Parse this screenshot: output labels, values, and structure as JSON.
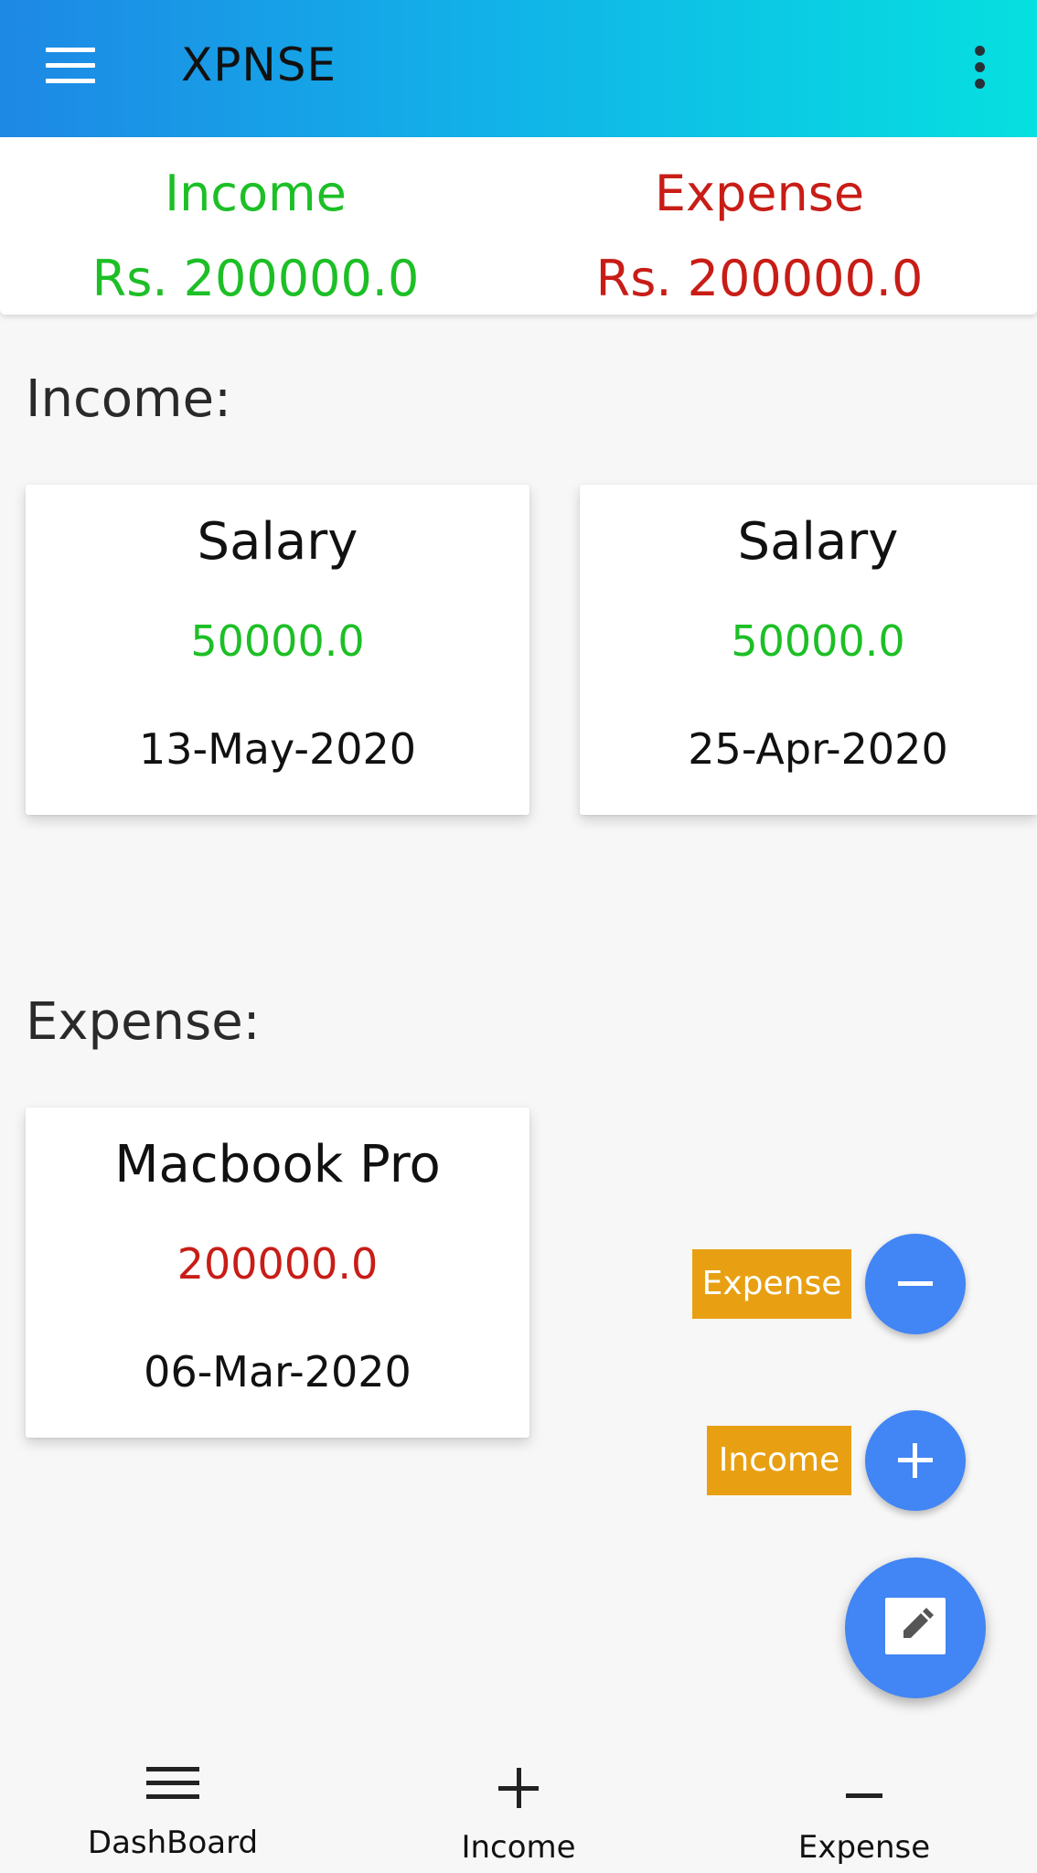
{
  "appbar": {
    "title": "XPNSE",
    "menu_icon": "menu-icon",
    "more_icon": "more-vert-icon"
  },
  "summary": {
    "income_label": "Income",
    "income_value": "Rs. 200000.0",
    "expense_label": "Expense",
    "expense_value": "Rs. 200000.0"
  },
  "income_section": {
    "title": "Income:",
    "cards": [
      {
        "title": "Salary",
        "amount": "50000.0",
        "date": "13-May-2020"
      },
      {
        "title": "Salary",
        "amount": "50000.0",
        "date": "25-Apr-2020"
      }
    ]
  },
  "expense_section": {
    "title": "Expense:",
    "cards": [
      {
        "title": "Macbook Pro",
        "amount": "200000.0",
        "date": "06-Mar-2020"
      }
    ]
  },
  "fab": {
    "expense_label": "Expense",
    "income_label": "Income",
    "main_icon": "edit-icon"
  },
  "bottom_nav": {
    "items": [
      {
        "label": "DashBoard",
        "icon": "menu-icon"
      },
      {
        "label": "Income",
        "icon": "plus-icon"
      },
      {
        "label": "Expense",
        "icon": "minus-icon"
      }
    ]
  },
  "colors": {
    "income": "#1dbf26",
    "expense": "#c81d17",
    "fab": "#4285f4",
    "fab_label": "#e8a012"
  }
}
